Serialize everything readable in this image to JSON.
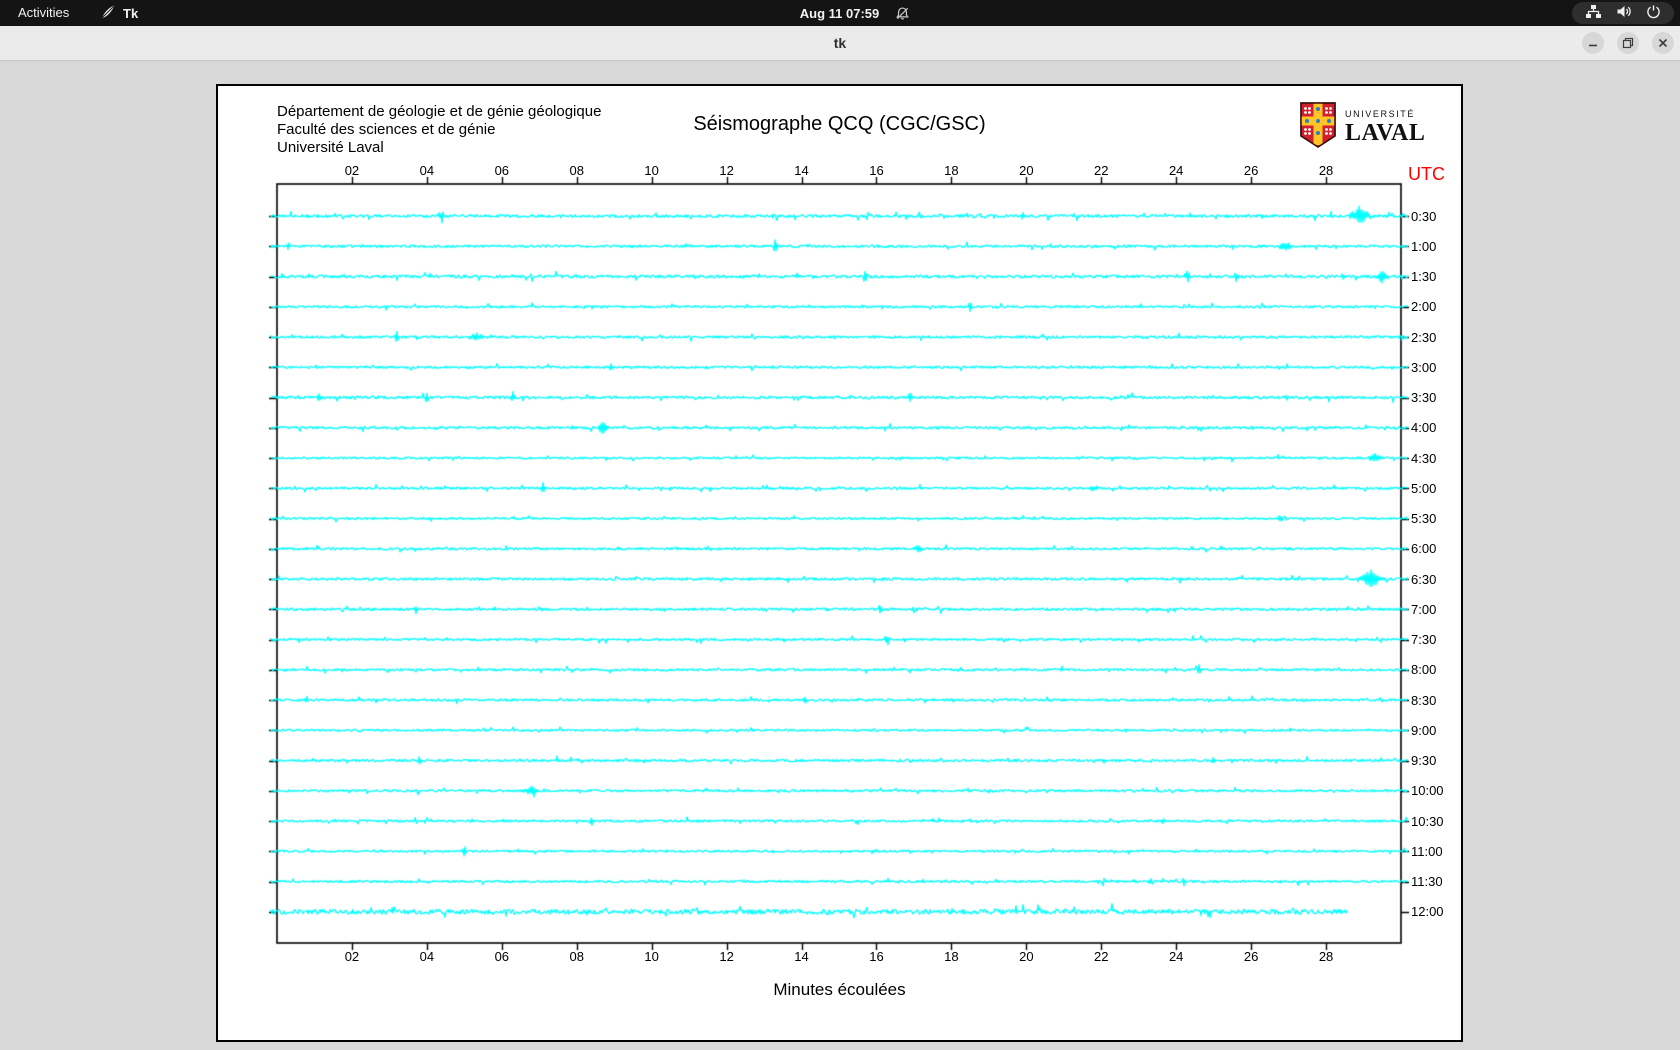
{
  "topbar": {
    "activities_label": "Activities",
    "app_name": "Tk",
    "clock": "Aug 11 07:59"
  },
  "titlebar": {
    "title": "tk"
  },
  "window": {
    "header_lines": [
      "Département de géologie et de génie géologique",
      "Faculté des sciences et de génie",
      "Université Laval"
    ],
    "logo": {
      "top": "UNIVERSITÉ",
      "bottom": "LAVAL"
    }
  },
  "chart_data": {
    "type": "line",
    "title": "Séismographe QCQ (CGC/GSC)",
    "xlabel": "Minutes écoulées",
    "right_axis_label": "UTC",
    "xlim": [
      0,
      30
    ],
    "x_tick_minutes": [
      2,
      4,
      6,
      8,
      10,
      12,
      14,
      16,
      18,
      20,
      22,
      24,
      26,
      28
    ],
    "x_tick_labels": [
      "02",
      "04",
      "06",
      "08",
      "10",
      "12",
      "14",
      "16",
      "18",
      "20",
      "22",
      "24",
      "26",
      "28"
    ],
    "trace_color": "#00ffff",
    "axis_color": "#000000",
    "utc_color": "#ff0000",
    "grid": false,
    "rows": [
      {
        "label": "0:30",
        "noise": 1.4,
        "events": [
          [
            4.4,
            7
          ],
          [
            19.9,
            4
          ],
          [
            28.9,
            8,
            0.7
          ]
        ]
      },
      {
        "label": "1:00",
        "noise": 1.2,
        "events": [
          [
            0.3,
            5
          ],
          [
            13.3,
            9
          ],
          [
            26.9,
            5,
            0.5
          ]
        ]
      },
      {
        "label": "1:30",
        "noise": 1.4,
        "events": [
          [
            15.7,
            9
          ],
          [
            24.3,
            7
          ],
          [
            25.6,
            6
          ],
          [
            29.5,
            7,
            0.4
          ]
        ]
      },
      {
        "label": "2:00",
        "noise": 1.1,
        "events": [
          [
            18.5,
            7
          ]
        ]
      },
      {
        "label": "2:30",
        "noise": 1.2,
        "events": [
          [
            3.2,
            6
          ],
          [
            5.3,
            4,
            0.5
          ]
        ]
      },
      {
        "label": "3:00",
        "noise": 1.1,
        "events": [
          [
            8.9,
            5
          ]
        ]
      },
      {
        "label": "3:30",
        "noise": 1.3,
        "events": [
          [
            1.1,
            6
          ],
          [
            4.0,
            6
          ],
          [
            6.3,
            6
          ],
          [
            16.9,
            8
          ]
        ]
      },
      {
        "label": "4:00",
        "noise": 1.2,
        "events": [
          [
            8.7,
            9,
            0.3
          ]
        ]
      },
      {
        "label": "4:30",
        "noise": 1.0,
        "events": [
          [
            29.3,
            4,
            0.5
          ]
        ]
      },
      {
        "label": "5:00",
        "noise": 1.1,
        "events": [
          [
            7.1,
            7
          ],
          [
            21.8,
            3,
            0.4
          ]
        ]
      },
      {
        "label": "5:30",
        "noise": 1.0,
        "events": [
          [
            26.8,
            3,
            0.4
          ]
        ]
      },
      {
        "label": "6:00",
        "noise": 1.1,
        "events": [
          [
            17.1,
            3,
            0.4
          ],
          [
            25.2,
            3
          ]
        ]
      },
      {
        "label": "6:30",
        "noise": 1.2,
        "events": [
          [
            29.2,
            9,
            0.7
          ]
        ]
      },
      {
        "label": "7:00",
        "noise": 1.2,
        "events": [
          [
            3.7,
            6
          ],
          [
            16.1,
            7
          ]
        ]
      },
      {
        "label": "7:30",
        "noise": 1.1,
        "events": [
          [
            16.3,
            7
          ]
        ]
      },
      {
        "label": "8:00",
        "noise": 1.1,
        "events": [
          [
            24.6,
            6
          ]
        ]
      },
      {
        "label": "8:30",
        "noise": 1.1,
        "events": [
          [
            0.8,
            4
          ],
          [
            14.1,
            6
          ]
        ]
      },
      {
        "label": "9:00",
        "noise": 1.0,
        "events": []
      },
      {
        "label": "9:30",
        "noise": 1.2,
        "events": [
          [
            3.8,
            6
          ],
          [
            25.0,
            4
          ]
        ]
      },
      {
        "label": "10:00",
        "noise": 1.1,
        "events": [
          [
            6.8,
            5,
            0.5
          ]
        ]
      },
      {
        "label": "10:30",
        "noise": 1.1,
        "events": [
          [
            8.4,
            6
          ]
        ]
      },
      {
        "label": "11:00",
        "noise": 1.0,
        "events": [
          [
            5.0,
            5
          ]
        ]
      },
      {
        "label": "11:30",
        "noise": 1.1,
        "events": [
          [
            23.3,
            4
          ],
          [
            24.2,
            5
          ]
        ]
      },
      {
        "label": "12:00",
        "noise": 2.3,
        "events": [],
        "end_minute": 28.6
      }
    ]
  }
}
